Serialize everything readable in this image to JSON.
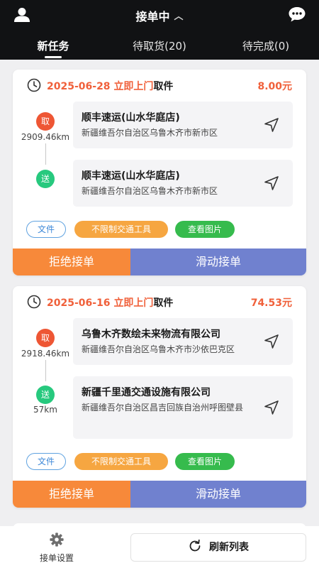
{
  "header": {
    "title": "接单中",
    "chevron": "^"
  },
  "tabs": [
    {
      "label": "新任务",
      "active": true
    },
    {
      "label": "待取货(20)",
      "active": false
    },
    {
      "label": "待完成(0)",
      "active": false
    }
  ],
  "orders": [
    {
      "date": "2025-06-28",
      "time_tag": "立即上门",
      "type": "取件",
      "price": "8.00元",
      "pickup": {
        "badge": "取",
        "distance": "2909.46km",
        "name": "顺丰速运(山水华庭店)",
        "address": "新疆维吾尔自治区乌鲁木齐市新市区"
      },
      "delivery": {
        "badge": "送",
        "distance": "",
        "name": "顺丰速运(山水华庭店)",
        "address": "新疆维吾尔自治区乌鲁木齐市新市区"
      },
      "tags": {
        "file": "文件",
        "vehicle": "不限制交通工具",
        "photo": "查看图片"
      },
      "reject_label": "拒绝接单",
      "accept_label": "滑动接单"
    },
    {
      "date": "2025-06-16",
      "time_tag": "立即上门",
      "type": "取件",
      "price": "74.53元",
      "pickup": {
        "badge": "取",
        "distance": "2918.46km",
        "name": "乌鲁木齐数绘未来物流有限公司",
        "address": "新疆维吾尔自治区乌鲁木齐市沙依巴克区"
      },
      "delivery": {
        "badge": "送",
        "distance": "57km",
        "name": "新疆千里通交通设施有限公司",
        "address": "新疆维吾尔自治区昌吉回族自治州呼图壁县"
      },
      "tags": {
        "file": "文件",
        "vehicle": "不限制交通工具",
        "photo": "查看图片"
      },
      "reject_label": "拒绝接单",
      "accept_label": "滑动接单"
    }
  ],
  "footer": {
    "settings_label": "接单设置",
    "refresh_label": "刷新列表"
  },
  "colors": {
    "topbar": "#111214",
    "accent": "#f0603a",
    "reject": "#f7893a",
    "accept": "#7081cf",
    "pickup": "#ee5634",
    "delivery": "#27c97e",
    "vehicle": "#f6a641",
    "photo": "#36bb4d"
  }
}
